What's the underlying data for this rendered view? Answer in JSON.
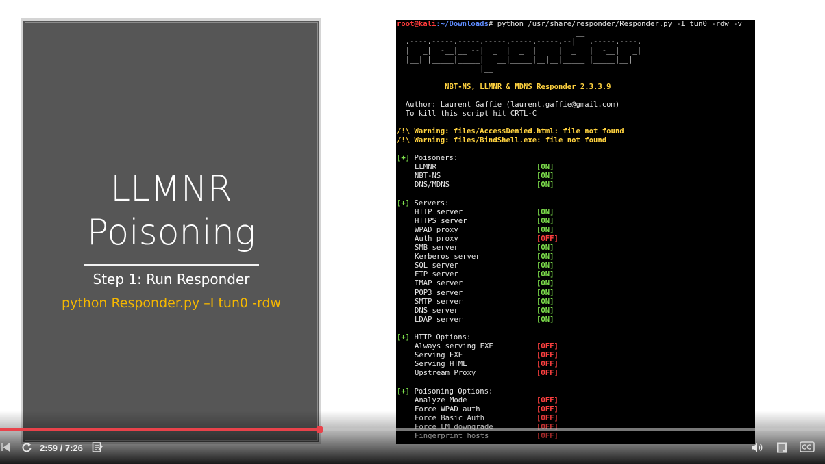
{
  "slide": {
    "title_line1": "LLMNR",
    "title_line2": "Poisoning",
    "step": "Step 1: Run Responder",
    "command": "python Responder.py –I tun0 -rdw"
  },
  "terminal": {
    "prompt_user": "root@kali",
    "prompt_path": ":~/Downloads",
    "prompt_cmd": "# python /usr/share/responder/Responder.py -I tun0 -rdw -v",
    "banner": [
      "                                         __",
      "  .----.-----.-----.-----.-----.-----.--|  |.-----.----.",
      "  |   _|  -__|__ --|  _  |  _  |     |  _  ||  -__|   _|",
      "  |__| |_____|_____|   __|_____|__|__|_____||_____|__|",
      "                   |__|"
    ],
    "banner_title": "           NBT-NS, LLMNR & MDNS Responder 2.3.3.9",
    "author": "  Author: Laurent Gaffie (laurent.gaffie@gmail.com)",
    "kill_hint": "  To kill this script hit CRTL-C",
    "warnings": [
      "/!\\ Warning: files/AccessDenied.html: file not found",
      "/!\\ Warning: files/BindShell.exe: file not found"
    ],
    "marker": "[+]",
    "sections": [
      {
        "title": " Poisoners:",
        "items": [
          {
            "name": "LLMNR",
            "value": "[ON]"
          },
          {
            "name": "NBT-NS",
            "value": "[ON]"
          },
          {
            "name": "DNS/MDNS",
            "value": "[ON]"
          }
        ]
      },
      {
        "title": " Servers:",
        "items": [
          {
            "name": "HTTP server",
            "value": "[ON]"
          },
          {
            "name": "HTTPS server",
            "value": "[ON]"
          },
          {
            "name": "WPAD proxy",
            "value": "[ON]"
          },
          {
            "name": "Auth proxy",
            "value": "[OFF]"
          },
          {
            "name": "SMB server",
            "value": "[ON]"
          },
          {
            "name": "Kerberos server",
            "value": "[ON]"
          },
          {
            "name": "SQL server",
            "value": "[ON]"
          },
          {
            "name": "FTP server",
            "value": "[ON]"
          },
          {
            "name": "IMAP server",
            "value": "[ON]"
          },
          {
            "name": "POP3 server",
            "value": "[ON]"
          },
          {
            "name": "SMTP server",
            "value": "[ON]"
          },
          {
            "name": "DNS server",
            "value": "[ON]"
          },
          {
            "name": "LDAP server",
            "value": "[ON]"
          }
        ]
      },
      {
        "title": " HTTP Options:",
        "items": [
          {
            "name": "Always serving EXE",
            "value": "[OFF]"
          },
          {
            "name": "Serving EXE",
            "value": "[OFF]"
          },
          {
            "name": "Serving HTML",
            "value": "[OFF]"
          },
          {
            "name": "Upstream Proxy",
            "value": "[OFF]"
          }
        ]
      },
      {
        "title": " Poisoning Options:",
        "items": [
          {
            "name": "Analyze Mode",
            "value": "[OFF]"
          },
          {
            "name": "Force WPAD auth",
            "value": "[OFF]"
          },
          {
            "name": "Force Basic Auth",
            "value": "[OFF]"
          },
          {
            "name": "Force LM downgrade",
            "value": "[OFF]"
          },
          {
            "name": "Fingerprint hosts",
            "value": "[OFF]"
          }
        ]
      }
    ]
  },
  "player": {
    "current_time": "2:59",
    "duration": "7:26",
    "time_display": "2:59 / 7:26",
    "progress_fraction": 0.387
  },
  "colors": {
    "progress": "#e8424a",
    "slide_bg": "#565656",
    "command_text": "#f5b700",
    "status_on": "#7ee04c",
    "status_off": "#ff4040"
  },
  "icons": {
    "replay": "replay-icon",
    "subtitles": "subtitles-icon",
    "volume": "volume-icon",
    "transcript": "transcript-icon",
    "captions": "cc-icon"
  }
}
